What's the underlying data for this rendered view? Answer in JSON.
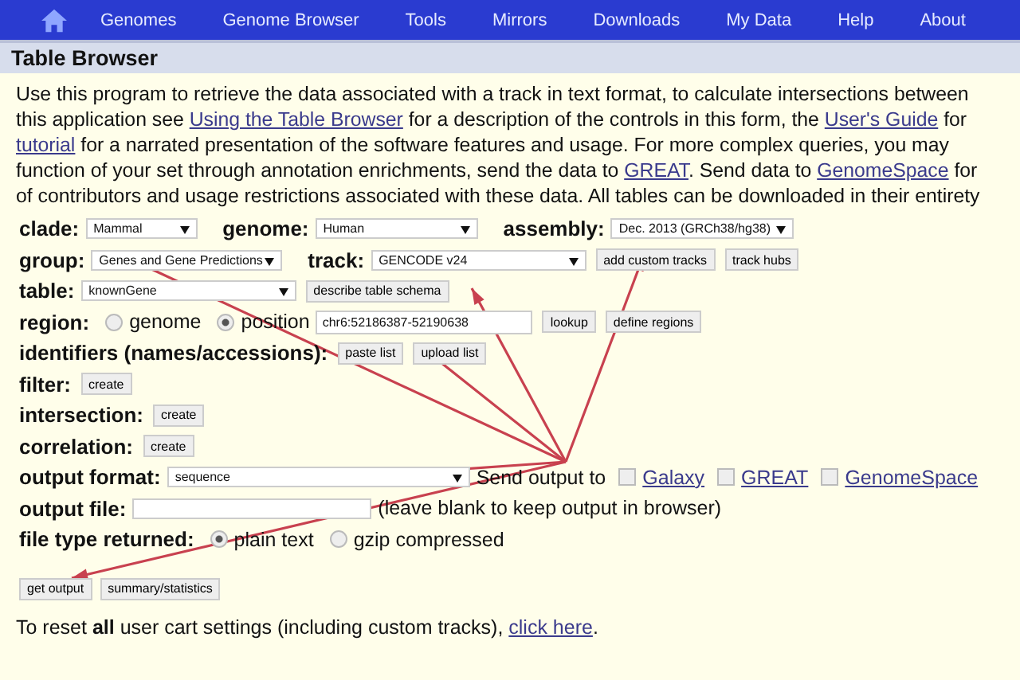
{
  "nav": {
    "items": [
      "Genomes",
      "Genome Browser",
      "Tools",
      "Mirrors",
      "Downloads",
      "My Data",
      "Help",
      "About"
    ]
  },
  "title": "Table Browser",
  "intro": [
    [
      {
        "kind": "text",
        "text": "Use this program to retrieve the data associated with a track in text format, to calculate intersections between"
      }
    ],
    [
      {
        "kind": "text",
        "text": "this application see "
      },
      {
        "kind": "link",
        "text": "Using the Table Browser"
      },
      {
        "kind": "text",
        "text": " for a description of the controls in this form, the "
      },
      {
        "kind": "link",
        "text": "User's Guide"
      },
      {
        "kind": "text",
        "text": " for"
      }
    ],
    [
      {
        "kind": "link",
        "text": "tutorial"
      },
      {
        "kind": "text",
        "text": " for a narrated presentation of the software features and usage. For more complex queries, you may"
      }
    ],
    [
      {
        "kind": "text",
        "text": "function of your set through annotation enrichments, send the data to "
      },
      {
        "kind": "link",
        "text": "GREAT"
      },
      {
        "kind": "text",
        "text": ". Send data to "
      },
      {
        "kind": "link",
        "text": "GenomeSpace"
      },
      {
        "kind": "text",
        "text": " for"
      }
    ],
    [
      {
        "kind": "text",
        "text": "of contributors and usage restrictions associated with these data. All tables can be downloaded in their entirety"
      }
    ]
  ],
  "rows": [
    {
      "kind": "selects",
      "items": [
        {
          "label": "clade:",
          "value": "Mammal"
        },
        {
          "label": "genome:",
          "value": "Human"
        },
        {
          "label": "assembly:",
          "value": "Dec. 2013 (GRCh38/hg38)"
        }
      ]
    },
    {
      "kind": "selects",
      "items": [
        {
          "label": "group:",
          "value": "Genes and Gene Predictions"
        },
        {
          "label": "track:",
          "value": "GENCODE v24"
        }
      ],
      "buttons": [
        "add custom tracks",
        "track hubs"
      ]
    },
    {
      "kind": "selects",
      "items": [
        {
          "label": "table:",
          "value": "knownGene"
        }
      ],
      "buttons": [
        "describe table schema"
      ]
    },
    {
      "kind": "region",
      "label": "region:",
      "options": [
        {
          "label": "genome",
          "selected": false
        },
        {
          "label": "position",
          "selected": true
        }
      ],
      "value": "chr6:52186387-52190638",
      "buttons": [
        "lookup",
        "define regions"
      ]
    },
    {
      "kind": "buttons",
      "label": "identifiers (names/accessions):",
      "buttons": [
        "paste list",
        "upload list"
      ]
    },
    {
      "kind": "buttons",
      "label": "filter:",
      "buttons": [
        "create"
      ]
    },
    {
      "kind": "buttons",
      "label": "intersection:",
      "buttons": [
        "create"
      ]
    },
    {
      "kind": "buttons",
      "label": "correlation:",
      "buttons": [
        "create"
      ]
    },
    {
      "kind": "output",
      "label": "output format:",
      "value": "sequence",
      "send_label": "Send output to",
      "targets": [
        {
          "label": "Galaxy",
          "checked": false
        },
        {
          "label": "GREAT",
          "checked": false
        },
        {
          "label": "GenomeSpace",
          "checked": false
        }
      ]
    },
    {
      "kind": "file",
      "label": "output file:",
      "note": "(leave blank to keep output in browser)"
    },
    {
      "kind": "region",
      "label": "file type returned:",
      "options": [
        {
          "label": "plain text",
          "selected": true
        },
        {
          "label": "gzip compressed",
          "selected": false
        }
      ]
    }
  ],
  "actions": [
    "get output",
    "summary/statistics"
  ],
  "footer": [
    {
      "kind": "text",
      "text": "To reset "
    },
    {
      "kind": "bold",
      "text": "all"
    },
    {
      "kind": "text",
      "text": " user cart settings (including custom tracks), "
    },
    {
      "kind": "link",
      "text": "click here"
    },
    {
      "kind": "text",
      "text": "."
    }
  ]
}
